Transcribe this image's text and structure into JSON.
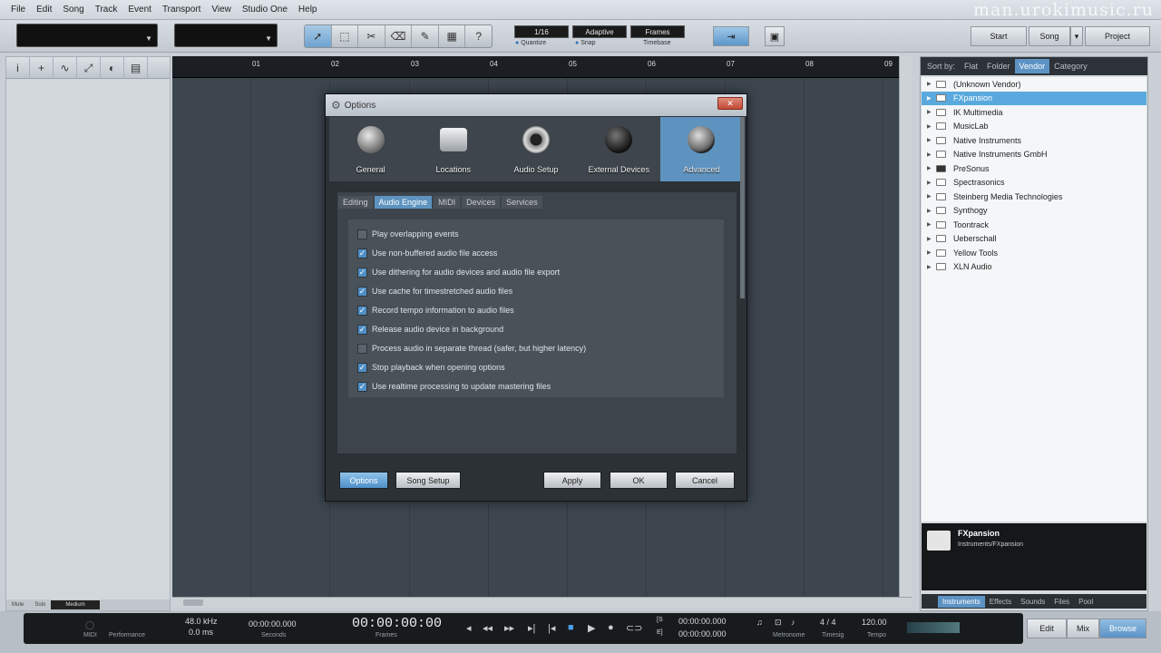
{
  "menu": [
    "File",
    "Edit",
    "Song",
    "Track",
    "Event",
    "Transport",
    "View",
    "Studio One",
    "Help"
  ],
  "watermark": "man.urokimusic.ru",
  "toolbar": {
    "quantize_value": "1/16",
    "snap_value": "Adaptive",
    "timebase_value": "Frames",
    "quantize_label": "Quantize",
    "snap_label": "Snap",
    "timebase_label": "Timebase",
    "nav": {
      "start": "Start",
      "song": "Song",
      "project": "Project"
    }
  },
  "ruler": [
    "01",
    "02",
    "03",
    "04",
    "05",
    "06",
    "07",
    "08",
    "09"
  ],
  "left_panel_footer": {
    "mute": "Mute",
    "solo": "Solo",
    "size": "Medium"
  },
  "browser": {
    "sort_label": "Sort by:",
    "sort_tabs": [
      "Flat",
      "Folder",
      "Vendor",
      "Category"
    ],
    "active_sort": "Vendor",
    "items": [
      "(Unknown Vendor)",
      "FXpansion",
      "IK Multimedia",
      "MusicLab",
      "Native Instruments",
      "Native Instruments GmbH",
      "PreSonus",
      "Spectrasonics",
      "Steinberg Media Technologies",
      "Synthogy",
      "Toontrack",
      "Ueberschall",
      "Yellow Tools",
      "XLN Audio"
    ],
    "selected_item": "FXpansion",
    "info_title": "FXpansion",
    "info_path": "Instruments/FXpansion",
    "bottom_tabs": [
      "Instruments",
      "Effects",
      "Sounds",
      "Files",
      "Pool"
    ],
    "active_bottom_tab": "Instruments"
  },
  "dialog": {
    "title": "Options",
    "categories": [
      "General",
      "Locations",
      "Audio Setup",
      "External Devices",
      "Advanced"
    ],
    "active_category": "Advanced",
    "subtabs": [
      "Editing",
      "Audio Engine",
      "MIDI",
      "Devices",
      "Services"
    ],
    "active_subtab": "Audio Engine",
    "options": [
      {
        "label": "Play overlapping events",
        "checked": false
      },
      {
        "label": "Use non-buffered audio file access",
        "checked": true
      },
      {
        "label": "Use dithering for audio devices and audio file export",
        "checked": true
      },
      {
        "label": "Use cache for timestretched audio files",
        "checked": true
      },
      {
        "label": "Record tempo information to audio files",
        "checked": true
      },
      {
        "label": "Release audio device in background",
        "checked": true
      },
      {
        "label": "Process audio in separate thread (safer, but higher latency)",
        "checked": false
      },
      {
        "label": "Stop playback when opening options",
        "checked": true
      },
      {
        "label": "Use realtime processing to update mastering files",
        "checked": true
      }
    ],
    "buttons": {
      "options": "Options",
      "song_setup": "Song Setup",
      "apply": "Apply",
      "ok": "OK",
      "cancel": "Cancel"
    }
  },
  "transport": {
    "midi": "MIDI",
    "performance": "Performance",
    "sample_rate": "48.0 kHz",
    "latency": "0.0 ms",
    "seconds_value": "00:00:00.000",
    "seconds_label": "Seconds",
    "frames_value": "00:00:00:00",
    "frames_label": "Frames",
    "loop_start": "00:00:00.000",
    "loop_end": "00:00:00.000",
    "metronome_label": "Metronome",
    "timesig_value": "4 / 4",
    "timesig_label": "Timesig",
    "tempo_value": "120.00",
    "tempo_label": "Tempo",
    "views": [
      "Edit",
      "Mix",
      "Browse"
    ],
    "active_view": "Browse"
  }
}
